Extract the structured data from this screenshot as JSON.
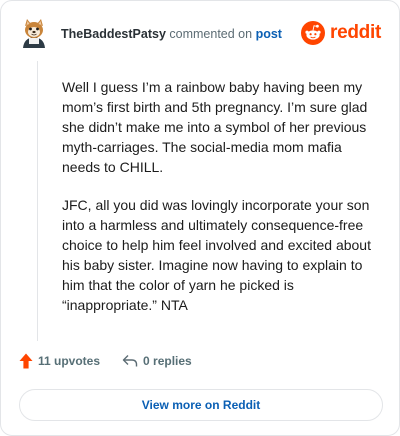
{
  "header": {
    "username": "TheBaddestPatsy",
    "action_text": "commented on",
    "post_link": "post"
  },
  "brand": {
    "wordmark": "reddit",
    "logo_icon": "reddit-snoo-icon",
    "accent_color": "#ff4500"
  },
  "comment": {
    "paragraphs": [
      "Well I guess I’m a rainbow baby having been my mom’s first birth and 5th pregnancy. I’m sure glad she didn’t make me into a symbol of her previous myth-carriages. The social-media mom mafia needs to CHILL.",
      "JFC, all you did was lovingly incorporate your son into a harmless and ultimately consequence-free choice to help him feel involved and excited about his baby sister. Imagine now having to explain to him that the color of yarn he picked is “inappropriate.” NTA"
    ]
  },
  "actions": {
    "upvotes": "11 upvotes",
    "upvote_icon": "upvote-arrow-icon",
    "replies": "0 replies",
    "reply_icon": "reply-arrow-icon"
  },
  "footer": {
    "view_more": "View more on Reddit",
    "link_color": "#0a5fb4"
  }
}
